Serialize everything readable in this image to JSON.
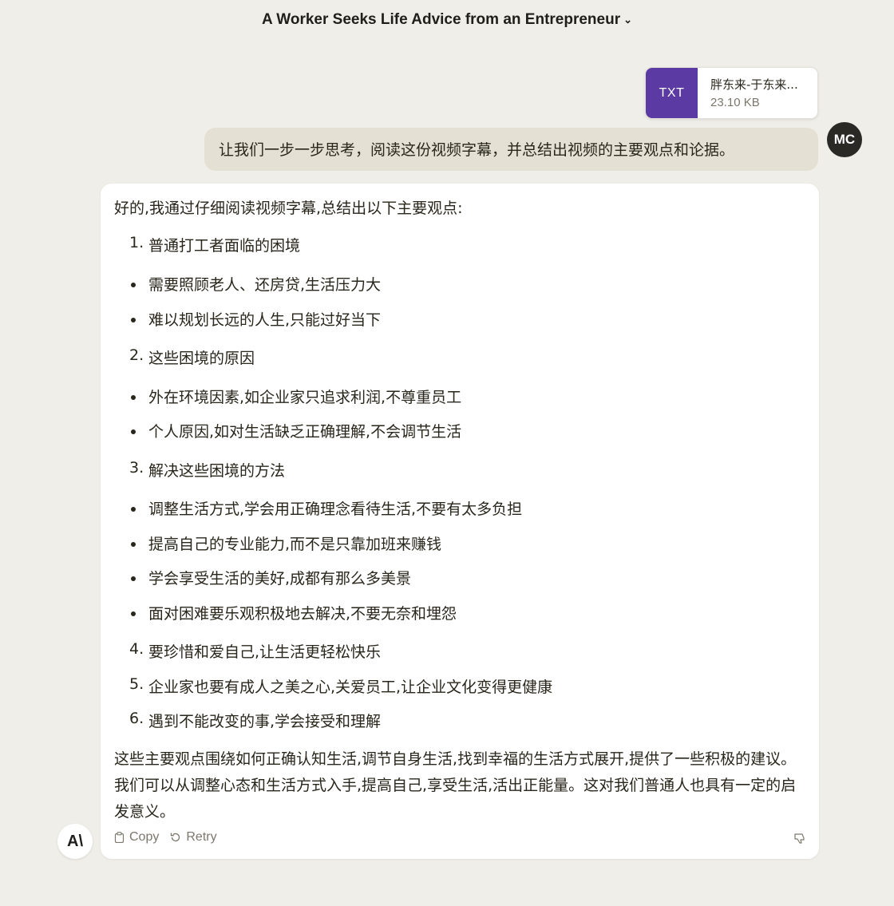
{
  "header": {
    "title": "A Worker Seeks Life Advice from an Entrepreneur",
    "chevron_icon": "chevron-down-icon"
  },
  "attachment": {
    "type_label": "TXT",
    "name": "胖东来-于东来...",
    "size": "23.10 KB"
  },
  "user_message": {
    "text": "让我们一步一步思考，阅读这份视频字幕，并总结出视频的主要观点和论据。",
    "avatar_initials": "MC"
  },
  "assistant": {
    "intro": "好的,我通过仔细阅读视频字幕,总结出以下主要观点:",
    "sections": [
      {
        "num": "1.",
        "title": "普通打工者面临的困境",
        "bullets": [
          "需要照顾老人、还房贷,生活压力大",
          "难以规划长远的人生,只能过好当下"
        ]
      },
      {
        "num": "2.",
        "title": "这些困境的原因",
        "bullets": [
          "外在环境因素,如企业家只追求利润,不尊重员工",
          "个人原因,如对生活缺乏正确理解,不会调节生活"
        ]
      },
      {
        "num": "3.",
        "title": "解决这些困境的方法",
        "bullets": [
          "调整生活方式,学会用正确理念看待生活,不要有太多负担",
          "提高自己的专业能力,而不是只靠加班来赚钱",
          "学会享受生活的美好,成都有那么多美景",
          "面对困难要乐观积极地去解决,不要无奈和埋怨"
        ]
      },
      {
        "num": "4.",
        "title": "要珍惜和爱自己,让生活更轻松快乐",
        "bullets": []
      },
      {
        "num": "5.",
        "title": "企业家也要有成人之美之心,关爱员工,让企业文化变得更健康",
        "bullets": []
      },
      {
        "num": "6.",
        "title": "遇到不能改变的事,学会接受和理解",
        "bullets": []
      }
    ],
    "conclusion": "这些主要观点围绕如何正确认知生活,调节自身生活,找到幸福的生活方式展开,提供了一些积极的建议。我们可以从调整心态和生活方式入手,提高自己,享受生活,活出正能量。这对我们普通人也具有一定的启发意义。",
    "actions": {
      "copy_label": "Copy",
      "retry_label": "Retry"
    },
    "logo_text": "A\\"
  }
}
